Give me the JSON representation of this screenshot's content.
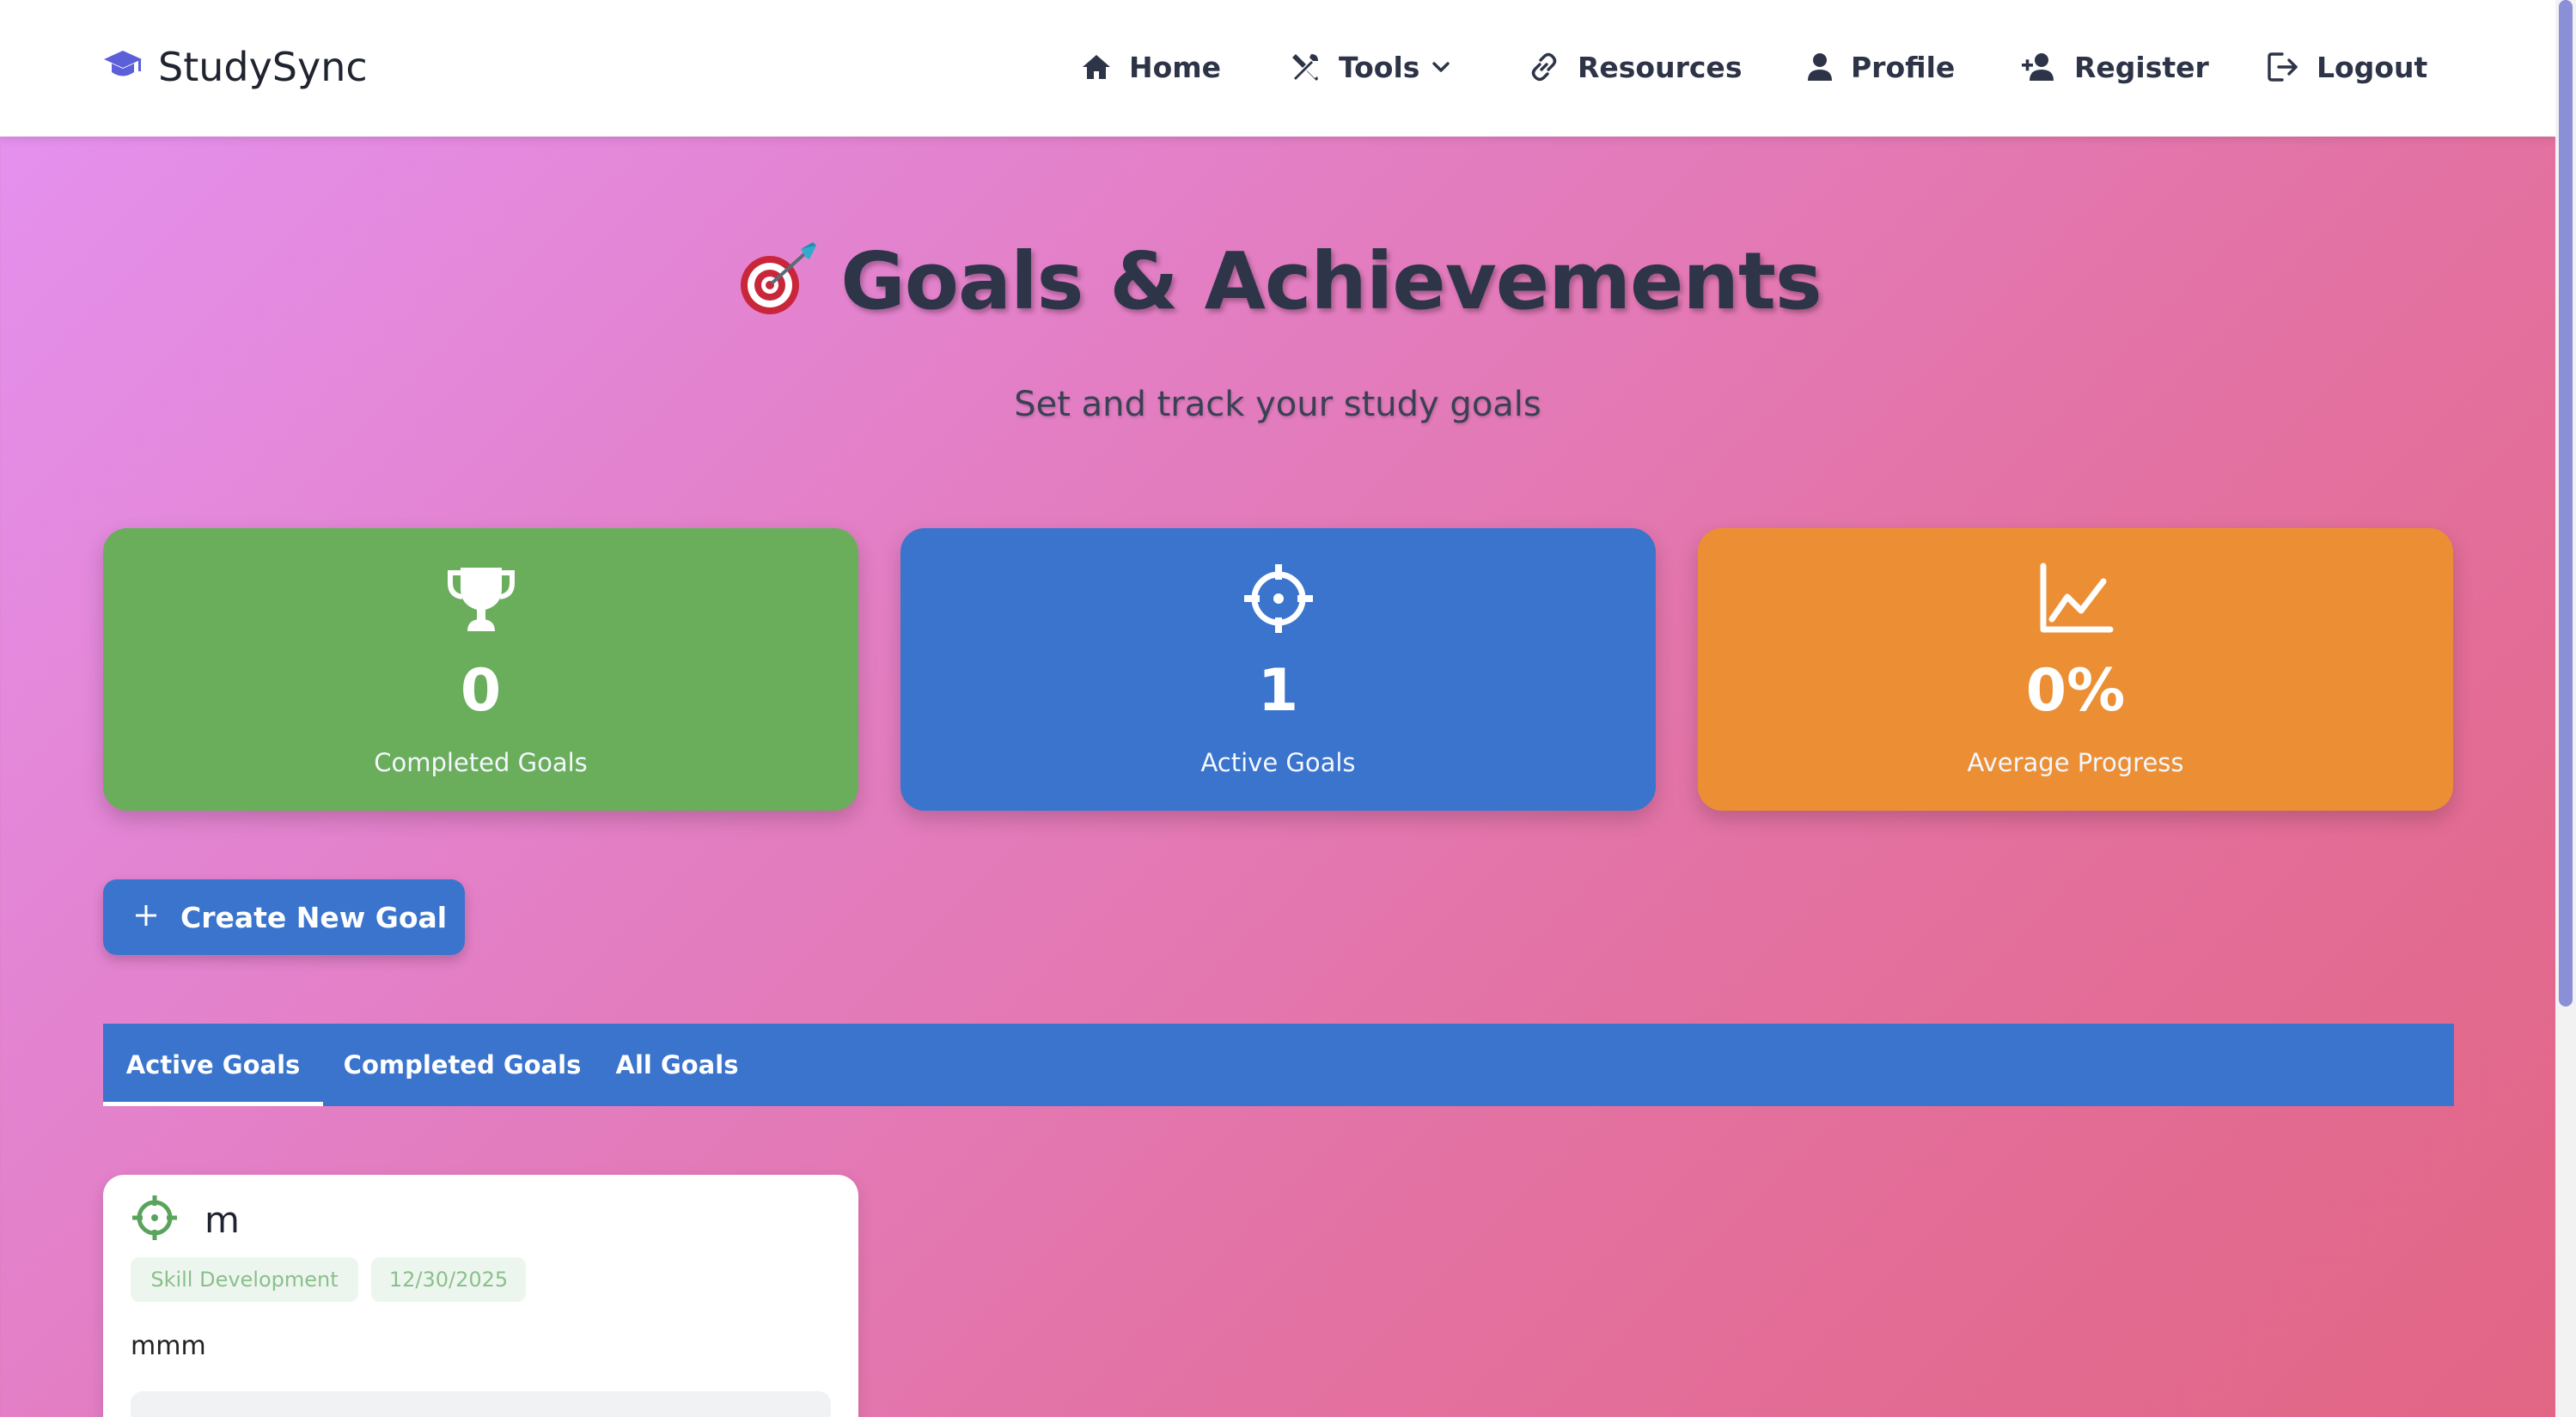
{
  "brand": {
    "name": "StudySync",
    "icon": "graduation-cap-icon"
  },
  "nav": {
    "home": "Home",
    "tools": "Tools",
    "resources": "Resources",
    "profile": "Profile",
    "register": "Register",
    "logout": "Logout"
  },
  "hero": {
    "emoji": "🎯",
    "title": "Goals & Achievements",
    "subtitle": "Set and track your study goals"
  },
  "stats": [
    {
      "value": "0",
      "label": "Completed Goals",
      "icon": "trophy-icon",
      "color": "#6aae5c"
    },
    {
      "value": "1",
      "label": "Active Goals",
      "icon": "crosshair-icon",
      "color": "#3a74cd"
    },
    {
      "value": "0%",
      "label": "Average Progress",
      "icon": "chart-line-icon",
      "color": "#ec8f34"
    }
  ],
  "create_button": {
    "label": "Create New Goal"
  },
  "tabs": [
    {
      "label": "Active Goals",
      "active": true
    },
    {
      "label": "Completed Goals",
      "active": false
    },
    {
      "label": "All Goals",
      "active": false
    }
  ],
  "goals": [
    {
      "title": "m",
      "category": "Skill Development",
      "date": "12/30/2025",
      "description": "mmm",
      "icon": "crosshair-icon",
      "icon_color": "#5aa35c"
    }
  ],
  "colors": {
    "primary": "#3a74cd",
    "success": "#6aae5c",
    "warning": "#ec8f34",
    "text_dark": "#2e3548"
  }
}
